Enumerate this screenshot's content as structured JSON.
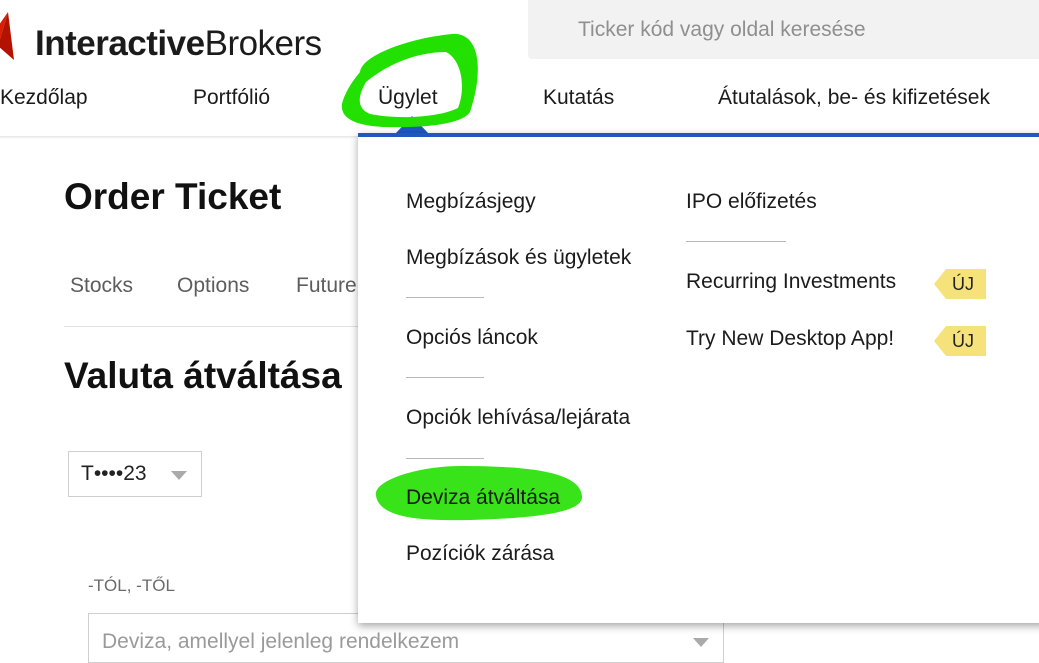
{
  "header": {
    "logo_bold": "Interactive",
    "logo_regular": "Brokers",
    "search_placeholder": "Ticker kód vagy oldal keresése"
  },
  "nav": {
    "items": [
      {
        "label": "Kezdőlap"
      },
      {
        "label": "Portfólió"
      },
      {
        "label": "Ügylet"
      },
      {
        "label": "Kutatás"
      },
      {
        "label": "Átutalások, be- és kifizetések"
      }
    ]
  },
  "page": {
    "title": "Order Ticket",
    "subtabs": [
      "Stocks",
      "Options",
      "Future"
    ],
    "section_title": "Valuta átváltása",
    "account_selector": "T••••23",
    "from_label": "-TÓL, -TŐL",
    "currency_placeholder": "Deviza, amellyel jelenleg rendelkezem"
  },
  "dropdown": {
    "left_column": [
      "Megbízásjegy",
      "Megbízások és ügyletek",
      "Opciós láncok",
      "Opciók lehívása/lejárata",
      "Deviza átváltása",
      "Pozíciók zárása"
    ],
    "right_column": [
      {
        "label": "IPO előfizetés",
        "badge": ""
      },
      {
        "label": "Recurring Investments",
        "badge": "ÚJ"
      },
      {
        "label": "Try New Desktop App!",
        "badge": "ÚJ"
      }
    ]
  },
  "colors": {
    "accent_blue": "#1f57c3",
    "logo_red": "#d81e05",
    "badge_yellow": "#f6e27a",
    "highlight_green": "#22e000"
  }
}
